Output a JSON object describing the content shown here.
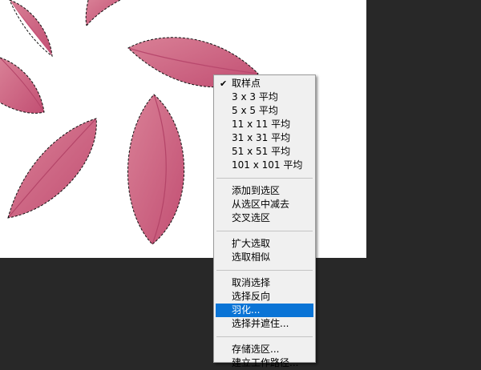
{
  "context_menu": {
    "sample_point": "取样点",
    "sample_3": "3 x 3 平均",
    "sample_5": "5 x 5 平均",
    "sample_11": "11 x 11 平均",
    "sample_31": "31 x 31 平均",
    "sample_51": "51 x 51 平均",
    "sample_101": "101 x 101 平均",
    "add_to_selection": "添加到选区",
    "subtract_from_selection": "从选区中减去",
    "intersect_selection": "交叉选区",
    "grow": "扩大选取",
    "similar": "选取相似",
    "deselect": "取消选择",
    "inverse": "选择反向",
    "feather": "羽化...",
    "select_and_mask": "选择并遮住...",
    "save_selection": "存储选区...",
    "make_work_path": "建立工作路径..."
  },
  "checked_item": "取样点",
  "highlighted_item": "羽化...",
  "colors": {
    "petal": "#c9557a",
    "petal_light": "#d97792",
    "background": "#282828",
    "menu_bg": "#f0f0f0",
    "highlight": "#0a74d6"
  }
}
